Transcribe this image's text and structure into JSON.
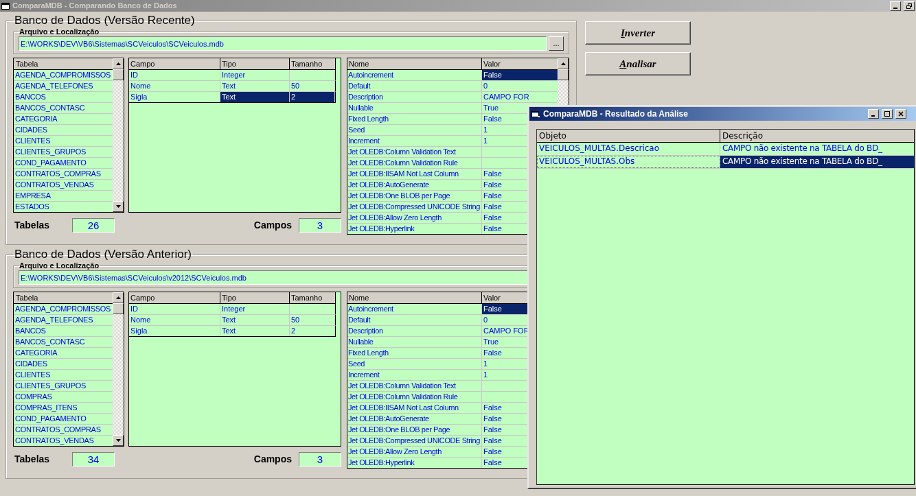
{
  "window": {
    "title": "ComparaMDB - Comparando Banco de Dados"
  },
  "sections": [
    {
      "title": "Banco de Dados (Versão Recente)",
      "file_label": "Arquivo e Localização",
      "path": "E:\\WORKS\\DEV\\VB6\\Sistemas\\SCVeiculos\\SCVeiculos.mdb",
      "browse_button": "...",
      "tables": {
        "header": "Tabela",
        "items": [
          "AGENDA_COMPROMISSOS",
          "AGENDA_TELEFONES",
          "BANCOS",
          "BANCOS_CONTASC",
          "CATEGORIA",
          "CIDADES",
          "CLIENTES",
          "CLIENTES_GRUPOS",
          "COND_PAGAMENTO",
          "CONTRATOS_COMPRAS",
          "CONTRATOS_VENDAS",
          "EMPRESA",
          "ESTADOS"
        ]
      },
      "fields": {
        "columns": [
          "Campo",
          "Tipo",
          "Tamanho"
        ],
        "rows": [
          {
            "cells": [
              "ID",
              "Integer",
              ""
            ],
            "selected": false
          },
          {
            "cells": [
              "Nome",
              "Text",
              "50"
            ],
            "selected": false
          },
          {
            "cells": [
              "Sigla",
              "Text",
              "2"
            ],
            "selected": true
          }
        ]
      },
      "properties": {
        "columns": [
          "Nome",
          "Valor"
        ],
        "rows": [
          {
            "name": "Autoincrement",
            "value": "False",
            "selected": true
          },
          {
            "name": "Default",
            "value": "0",
            "selected": false
          },
          {
            "name": "Description",
            "value": "CAMPO FOR",
            "selected": false
          },
          {
            "name": "Nullable",
            "value": "True",
            "selected": false
          },
          {
            "name": "Fixed Length",
            "value": "False",
            "selected": false
          },
          {
            "name": "Seed",
            "value": "1",
            "selected": false
          },
          {
            "name": "Increment",
            "value": "1",
            "selected": false
          },
          {
            "name": "Jet OLEDB:Column Validation Text",
            "value": "",
            "selected": false
          },
          {
            "name": "Jet OLEDB:Column Validation Rule",
            "value": "",
            "selected": false
          },
          {
            "name": "Jet OLEDB:IISAM Not Last Column",
            "value": "False",
            "selected": false
          },
          {
            "name": "Jet OLEDB:AutoGenerate",
            "value": "False",
            "selected": false
          },
          {
            "name": "Jet OLEDB:One BLOB per Page",
            "value": "False",
            "selected": false
          },
          {
            "name": "Jet OLEDB:Compressed UNICODE String",
            "value": "False",
            "selected": false
          },
          {
            "name": "Jet OLEDB:Allow Zero Length",
            "value": "False",
            "selected": false
          },
          {
            "name": "Jet OLEDB:Hyperlink",
            "value": "False",
            "selected": false
          }
        ]
      },
      "tables_label": "Tabelas",
      "tables_count": "26",
      "fields_label": "Campos",
      "fields_count": "3"
    },
    {
      "title": "Banco de Dados (Versão Anterior)",
      "file_label": "Arquivo e Localização",
      "path": "E:\\WORKS\\DEV\\VB6\\Sistemas\\SCVeiculos\\v2012\\SCVeiculos.mdb",
      "tables": {
        "header": "Tabela",
        "items": [
          "AGENDA_COMPROMISSOS",
          "AGENDA_TELEFONES",
          "BANCOS",
          "BANCOS_CONTASC",
          "CATEGORIA",
          "CIDADES",
          "CLIENTES",
          "CLIENTES_GRUPOS",
          "COMPRAS",
          "COMPRAS_ITENS",
          "COND_PAGAMENTO",
          "CONTRATOS_COMPRAS",
          "CONTRATOS_VENDAS"
        ]
      },
      "fields": {
        "columns": [
          "Campo",
          "Tipo",
          "Tamanho"
        ],
        "rows": [
          {
            "cells": [
              "ID",
              "Integer",
              ""
            ],
            "selected": false
          },
          {
            "cells": [
              "Nome",
              "Text",
              "50"
            ],
            "selected": false
          },
          {
            "cells": [
              "Sigla",
              "Text",
              "2"
            ],
            "selected": false
          }
        ]
      },
      "properties": {
        "columns": [
          "Nome",
          "Valor"
        ],
        "rows": [
          {
            "name": "Autoincrement",
            "value": "False",
            "selected": true
          },
          {
            "name": "Default",
            "value": "0",
            "selected": false
          },
          {
            "name": "Description",
            "value": "CAMPO FOR",
            "selected": false
          },
          {
            "name": "Nullable",
            "value": "True",
            "selected": false
          },
          {
            "name": "Fixed Length",
            "value": "False",
            "selected": false
          },
          {
            "name": "Seed",
            "value": "1",
            "selected": false
          },
          {
            "name": "Increment",
            "value": "1",
            "selected": false
          },
          {
            "name": "Jet OLEDB:Column Validation Text",
            "value": "",
            "selected": false
          },
          {
            "name": "Jet OLEDB:Column Validation Rule",
            "value": "",
            "selected": false
          },
          {
            "name": "Jet OLEDB:IISAM Not Last Column",
            "value": "False",
            "selected": false
          },
          {
            "name": "Jet OLEDB:AutoGenerate",
            "value": "False",
            "selected": false
          },
          {
            "name": "Jet OLEDB:One BLOB per Page",
            "value": "False",
            "selected": false
          },
          {
            "name": "Jet OLEDB:Compressed UNICODE String",
            "value": "False",
            "selected": false
          },
          {
            "name": "Jet OLEDB:Allow Zero Length",
            "value": "False",
            "selected": false
          },
          {
            "name": "Jet OLEDB:Hyperlink",
            "value": "False",
            "selected": false
          }
        ]
      },
      "tables_label": "Tabelas",
      "tables_count": "34",
      "fields_label": "Campos",
      "fields_count": "3"
    }
  ],
  "buttons": [
    {
      "label": "Inverter"
    },
    {
      "label": "Analisar"
    }
  ],
  "result_window": {
    "title": "ComparaMDB - Resultado da Análise",
    "columns": [
      "Objeto",
      "Descrição"
    ],
    "rows": [
      {
        "object": "VEICULOS_MULTAS.Descricao",
        "description": "CAMPO não existente na TABELA do BD_",
        "selected": false
      },
      {
        "object": "VEICULOS_MULTAS.Obs",
        "description": "CAMPO não existente na TABELA do BD_",
        "selected": true
      }
    ]
  }
}
